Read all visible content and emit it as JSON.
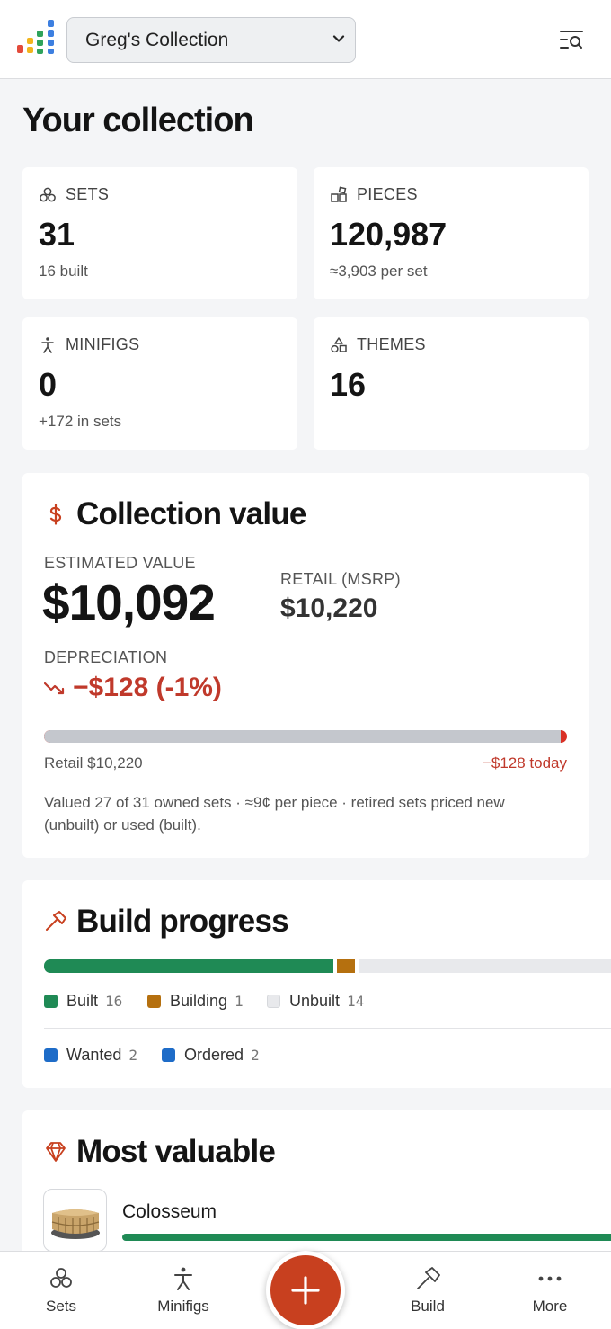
{
  "header": {
    "collection_select": "Greg's Collection"
  },
  "page_title": "Your collection",
  "stats": {
    "sets": {
      "label": "SETS",
      "value": "31",
      "sub": "16 built"
    },
    "pieces": {
      "label": "PIECES",
      "value": "120,987",
      "sub": "≈3,903 per set"
    },
    "minifigs": {
      "label": "MINIFIGS",
      "value": "0",
      "sub": "+172 in sets"
    },
    "themes": {
      "label": "THEMES",
      "value": "16"
    }
  },
  "value_section": {
    "title": "Collection value",
    "estimated_label": "ESTIMATED VALUE",
    "estimated_value": "$10,092",
    "retail_label": "RETAIL (MSRP)",
    "retail_value": "$10,220",
    "depreciation_label": "DEPRECIATION",
    "depreciation_value": "−$128 (-1%)",
    "bar_retained_fraction": 0.9875,
    "bar_left_label": "Retail $10,220",
    "bar_right_label": "−$128 today",
    "note": "Valued 27 of 31 owned sets · ≈9¢ per piece · retired sets priced new (unbuilt) or used (built)."
  },
  "build_section": {
    "title": "Build progress",
    "segments": [
      {
        "name": "Built",
        "count": 16,
        "color": "#1f8a55"
      },
      {
        "name": "Building",
        "count": 1,
        "color": "#b5700f"
      },
      {
        "name": "Unbuilt",
        "count": 14,
        "color": "#e8e9ec"
      }
    ],
    "legend": [
      {
        "label": "Built",
        "count": "16"
      },
      {
        "label": "Building",
        "count": "1"
      },
      {
        "label": "Unbuilt",
        "count": "14"
      }
    ],
    "legend2": [
      {
        "label": "Wanted",
        "count": "2"
      },
      {
        "label": "Ordered",
        "count": "2"
      }
    ]
  },
  "valuable_section": {
    "title": "Most valuable",
    "items": [
      {
        "name": "Colosseum"
      }
    ]
  },
  "nav": {
    "sets": "Sets",
    "minifigs": "Minifigs",
    "build": "Build",
    "more": "More"
  },
  "colors": {
    "accent": "#c8401f",
    "built": "#1f8a55",
    "building": "#b5700f",
    "wanted": "#1e6cc8",
    "negative": "#c0392b"
  }
}
